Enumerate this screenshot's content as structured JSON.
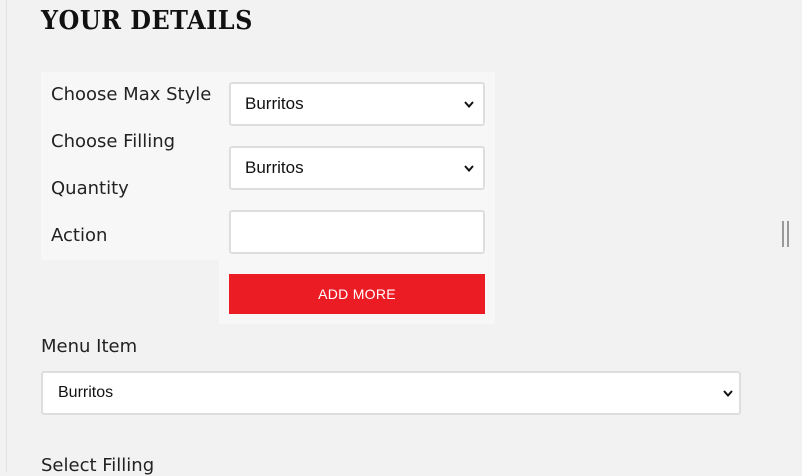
{
  "page_title": "YOUR DETAILS",
  "form": {
    "labels": {
      "max_style": "Choose Max Style",
      "filling": "Choose Filling",
      "quantity": "Quantity",
      "action": "Action"
    },
    "max_style_select": {
      "value": "Burritos",
      "icon": "chevron-down-icon"
    },
    "filling_select": {
      "value": "Burritos",
      "icon": "chevron-down-icon"
    },
    "quantity_input": {
      "value": ""
    },
    "add_button_label": "ADD MORE"
  },
  "menu_item": {
    "label": "Menu Item",
    "select": {
      "value": "Burritos",
      "icon": "chevron-down-icon"
    }
  },
  "select_filling": {
    "label": "Select Filling"
  },
  "colors": {
    "accent": "#ec1c24",
    "background": "#f2f2f2",
    "panel": "#f7f7f7"
  }
}
